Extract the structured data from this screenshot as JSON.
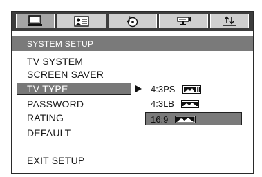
{
  "header": {
    "tabs": [
      {
        "icon": "monitor-icon",
        "selected": true
      },
      {
        "icon": "person-card-icon",
        "selected": false
      },
      {
        "icon": "audio-disc-icon",
        "selected": false
      },
      {
        "icon": "video-camera-icon",
        "selected": false
      },
      {
        "icon": "preference-arrows-icon",
        "selected": false
      }
    ]
  },
  "section_title": "SYSTEM SETUP",
  "menu": {
    "tv_system": "TV SYSTEM",
    "screen_saver": "SCREEN SAVER",
    "tv_type": "TV TYPE",
    "password": "PASSWORD",
    "rating": "RATING",
    "default": "DEFAULT",
    "exit_setup": "EXIT SETUP"
  },
  "submenu": {
    "options": [
      {
        "label": "4:3PS",
        "icon": "pan-scan-icon"
      },
      {
        "label": "4:3LB",
        "icon": "letterbox-icon"
      },
      {
        "label": "16:9",
        "icon": "widescreen-icon",
        "highlighted": true
      }
    ]
  },
  "colors": {
    "tab_bar": "#3d3d3d",
    "tab": "#cfcfcf",
    "title_bar": "#7a7a7a",
    "selection": "#787878"
  }
}
